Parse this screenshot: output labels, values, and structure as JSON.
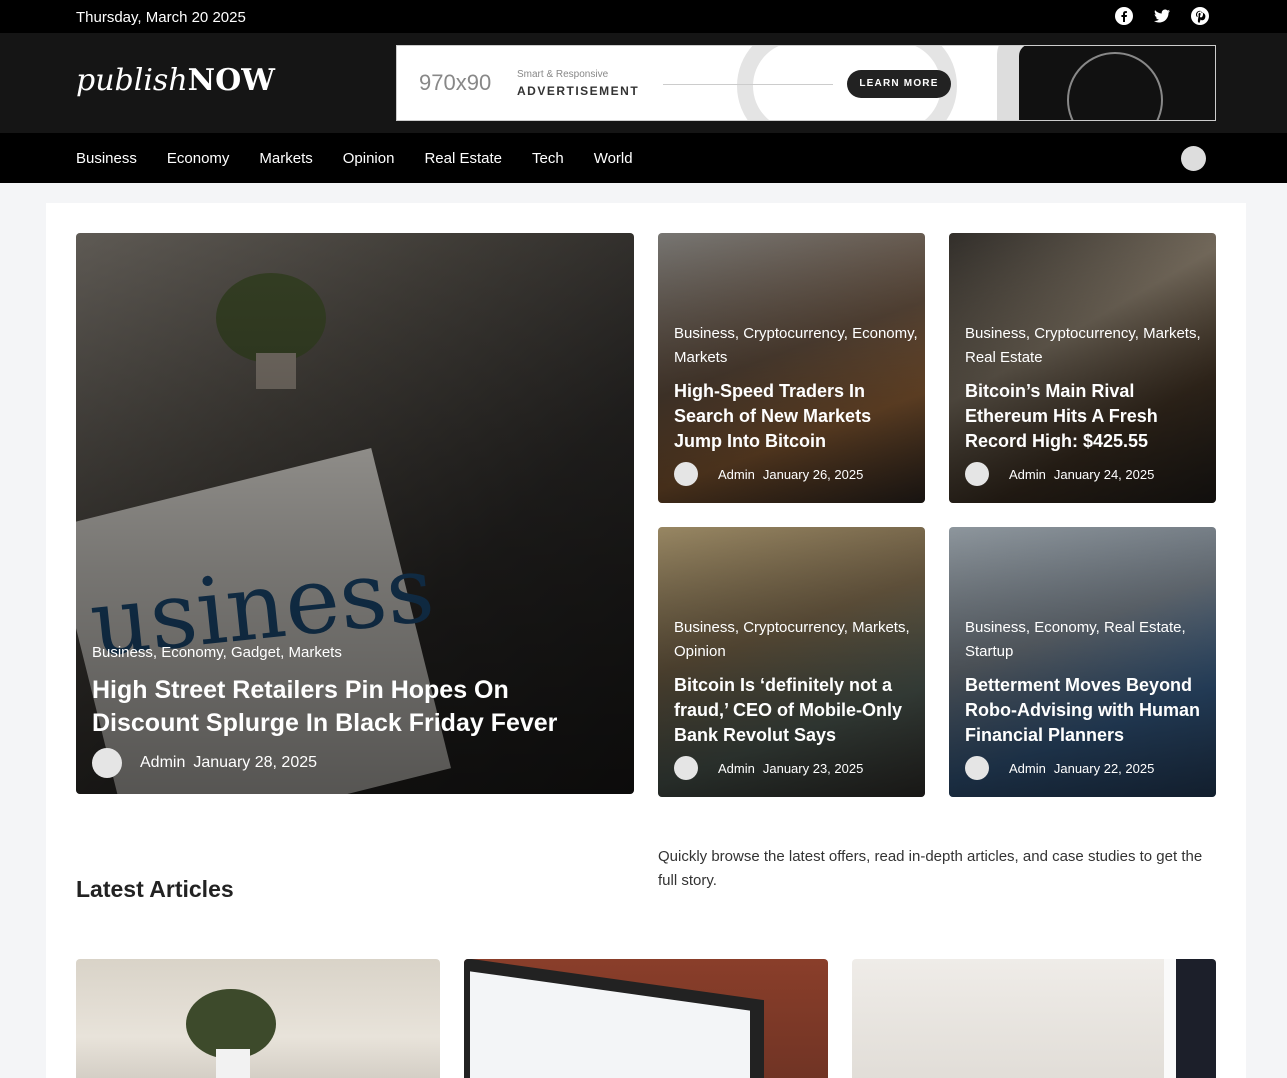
{
  "topbar": {
    "date": "Thursday, March 20 2025",
    "social_icons": [
      "facebook-icon",
      "twitter-icon",
      "pinterest-icon"
    ]
  },
  "header": {
    "logo_part1": "publish",
    "logo_part2": "NOW",
    "ad": {
      "size": "970x90",
      "subtitle": "Smart & Responsive",
      "title": "ADVERTISEMENT",
      "button": "LEARN MORE"
    }
  },
  "nav": {
    "items": [
      "Business",
      "Economy",
      "Markets",
      "Opinion",
      "Real Estate",
      "Tech",
      "World"
    ]
  },
  "featured": {
    "main": {
      "categories": "Business, Economy, Gadget, Markets",
      "title": "High Street Retailers Pin Hopes On Discount Splurge In Black Friday Fever",
      "author": "Admin",
      "date": "January 28, 2025",
      "image_word": "usiness"
    },
    "side": [
      {
        "categories": "Business, Cryptocurrency, Economy, Markets",
        "title": "High-Speed Traders In Search of New Markets Jump Into Bitcoin",
        "author": "Admin",
        "date": "January 26, 2025"
      },
      {
        "categories": "Business, Cryptocurrency, Markets, Real Estate",
        "title": "Bitcoin’s Main Rival Ethereum Hits A Fresh Record High: $425.55",
        "author": "Admin",
        "date": "January 24, 2025"
      },
      {
        "categories": "Business, Cryptocurrency, Markets, Opinion",
        "title": "Bitcoin Is ‘definitely not a fraud,’ CEO of Mobile-Only Bank Revolut Says",
        "author": "Admin",
        "date": "January 23, 2025"
      },
      {
        "categories": "Business, Economy, Real Estate, Startup",
        "title": "Betterment Moves Beyond Robo-Advising with Human Financial Planners",
        "author": "Admin",
        "date": "January 22, 2025"
      }
    ]
  },
  "latest": {
    "heading": "Latest Articles",
    "description": "Quickly browse the latest offers, read in-depth articles, and case studies to get the full story."
  }
}
